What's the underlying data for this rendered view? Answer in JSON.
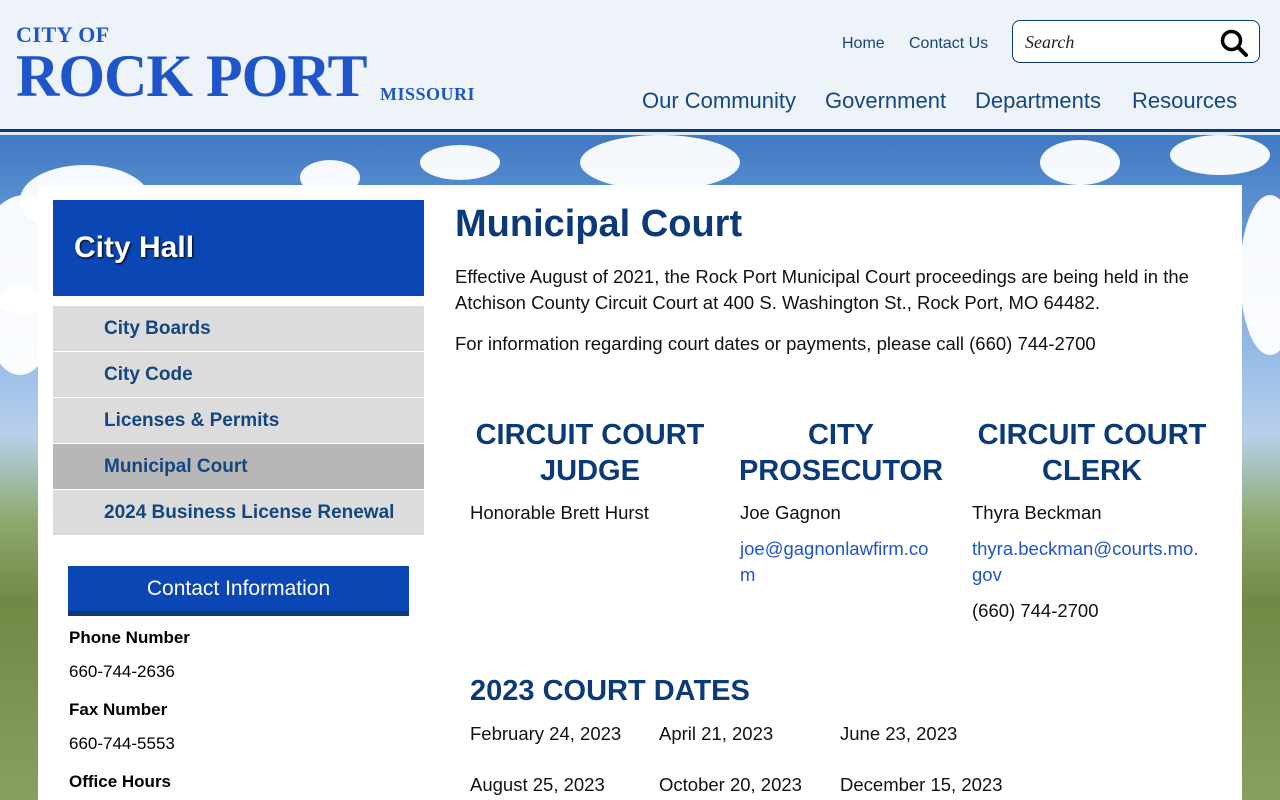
{
  "header": {
    "logo": {
      "city_of": "CITY OF",
      "name": "ROCK PORT",
      "state": "MISSOURI"
    },
    "util_nav": [
      {
        "label": "Home"
      },
      {
        "label": "Contact Us"
      }
    ],
    "search": {
      "placeholder": "Search",
      "icon": "search-icon"
    },
    "main_nav": [
      {
        "label": "Our Community"
      },
      {
        "label": "Government"
      },
      {
        "label": "Departments"
      },
      {
        "label": "Resources"
      }
    ]
  },
  "sidebar": {
    "title": "City Hall",
    "items": [
      {
        "label": "City Boards"
      },
      {
        "label": "City Code"
      },
      {
        "label": "Licenses & Permits"
      },
      {
        "label": "Municipal Court"
      },
      {
        "label": "2024 Business License Renewal"
      }
    ],
    "contact": {
      "heading": "Contact Information",
      "phone_label": "Phone Number",
      "phone": "660-744-2636",
      "fax_label": "Fax Number",
      "fax": "660-744-5553",
      "hours_label": "Office Hours"
    }
  },
  "main": {
    "title": "Municipal Court",
    "para1": "Effective August of 2021, the Rock Port Municipal Court proceedings are being held in the Atchison County Circuit Court at 400 S. Washington St., Rock Port, MO 64482.",
    "para2": "For information regarding court dates or payments, please call (660) 744-2700",
    "columns": [
      {
        "heading": "CIRCUIT COURT JUDGE",
        "name": "Honorable Brett Hurst"
      },
      {
        "heading": "CITY PROSECUTOR",
        "name": "Joe Gagnon",
        "email": "joe@gagnonlawfirm.com"
      },
      {
        "heading": "CIRCUIT COURT CLERK",
        "name": "Thyra Beckman",
        "email": "thyra.beckman@courts.mo.gov",
        "phone": "(660) 744-2700"
      }
    ],
    "dates_title": "2023 COURT DATES",
    "dates": [
      "February 24, 2023",
      "April 21, 2023",
      "June 23, 2023",
      "August 25, 2023",
      "October 20, 2023",
      "December 15, 2023"
    ]
  }
}
